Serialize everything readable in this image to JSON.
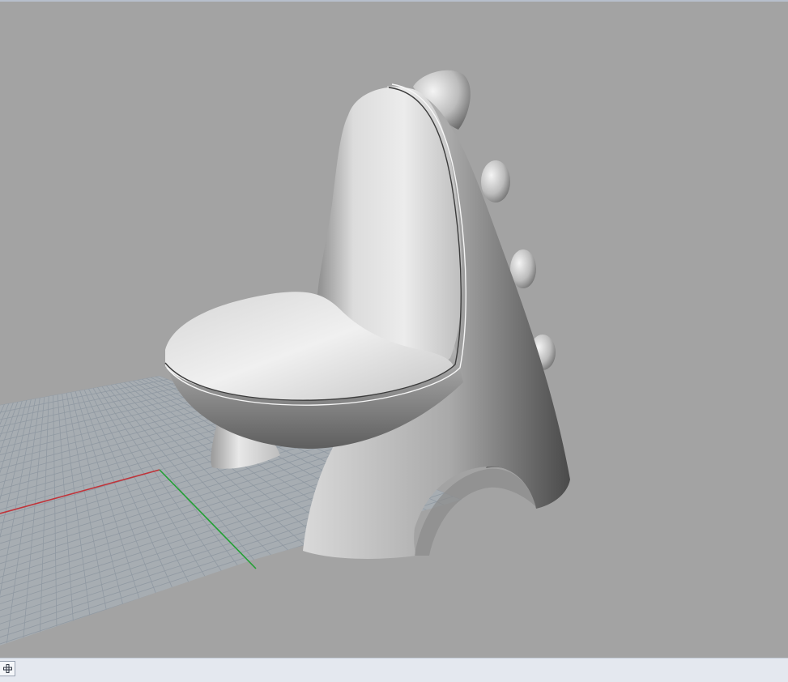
{
  "viewport": {
    "background": "#a3a3a3",
    "grid_color": "#9aa4ad",
    "x_axis_color": "#c0343a",
    "y_axis_color": "#23a034",
    "model": "dinosaur-chair",
    "shading": "rendered"
  },
  "bottom_bar": {
    "add_tab_icon": "plus-square-icon"
  }
}
